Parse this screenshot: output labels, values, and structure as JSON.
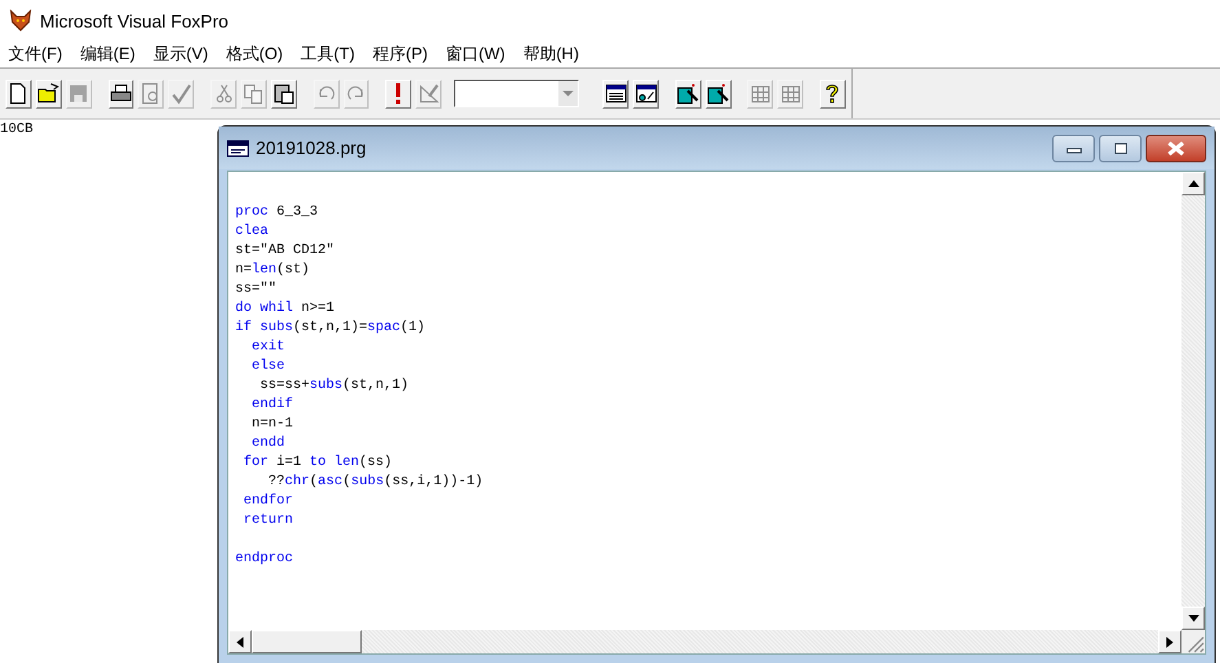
{
  "app_title": "Microsoft Visual FoxPro",
  "menu": [
    {
      "label": "文件(F)"
    },
    {
      "label": "编辑(E)"
    },
    {
      "label": "显示(V)"
    },
    {
      "label": "格式(O)"
    },
    {
      "label": "工具(T)"
    },
    {
      "label": "程序(P)"
    },
    {
      "label": "窗口(W)"
    },
    {
      "label": "帮助(H)"
    }
  ],
  "toolbar": [
    {
      "kind": "new",
      "disabled": false
    },
    {
      "kind": "open",
      "disabled": false
    },
    {
      "kind": "save",
      "disabled": true
    },
    {
      "kind": "separator"
    },
    {
      "kind": "print",
      "disabled": false
    },
    {
      "kind": "preview",
      "disabled": true
    },
    {
      "kind": "spell",
      "disabled": true
    },
    {
      "kind": "separator"
    },
    {
      "kind": "cut",
      "disabled": true
    },
    {
      "kind": "copy",
      "disabled": true
    },
    {
      "kind": "paste",
      "disabled": false
    },
    {
      "kind": "separator"
    },
    {
      "kind": "undo",
      "disabled": true
    },
    {
      "kind": "redo",
      "disabled": true
    },
    {
      "kind": "separator"
    },
    {
      "kind": "run",
      "disabled": false
    },
    {
      "kind": "modify",
      "disabled": true
    },
    {
      "kind": "combo"
    },
    {
      "kind": "separator"
    },
    {
      "kind": "form",
      "disabled": false
    },
    {
      "kind": "report",
      "disabled": false
    },
    {
      "kind": "separator"
    },
    {
      "kind": "wizard",
      "disabled": false
    },
    {
      "kind": "wizard",
      "disabled": false
    },
    {
      "kind": "separator"
    },
    {
      "kind": "grid",
      "disabled": true
    },
    {
      "kind": "grid",
      "disabled": true
    },
    {
      "kind": "separator"
    },
    {
      "kind": "help",
      "disabled": false
    }
  ],
  "desktop_text": "10CB",
  "editor": {
    "title": "20191028.prg",
    "lines": [
      {
        "tokens": [
          {
            "t": "proc",
            "kw": true
          },
          {
            "t": " 6_3_3",
            "kw": false
          }
        ]
      },
      {
        "tokens": [
          {
            "t": "clea",
            "kw": true
          }
        ]
      },
      {
        "tokens": [
          {
            "t": "st=\"AB CD12\"",
            "kw": false
          }
        ]
      },
      {
        "tokens": [
          {
            "t": "n=",
            "kw": false
          },
          {
            "t": "len",
            "kw": true
          },
          {
            "t": "(st)",
            "kw": false
          }
        ]
      },
      {
        "tokens": [
          {
            "t": "ss=\"\"",
            "kw": false
          }
        ]
      },
      {
        "tokens": [
          {
            "t": "do whil",
            "kw": true
          },
          {
            "t": " n>=1",
            "kw": false
          }
        ]
      },
      {
        "tokens": [
          {
            "t": "if subs",
            "kw": true
          },
          {
            "t": "(st,n,1)=",
            "kw": false
          },
          {
            "t": "spac",
            "kw": true
          },
          {
            "t": "(1)",
            "kw": false
          }
        ]
      },
      {
        "tokens": [
          {
            "t": "  exit",
            "kw": true
          }
        ]
      },
      {
        "tokens": [
          {
            "t": "  else",
            "kw": true
          }
        ]
      },
      {
        "tokens": [
          {
            "t": "   ss=ss+",
            "kw": false
          },
          {
            "t": "subs",
            "kw": true
          },
          {
            "t": "(st,n,1)",
            "kw": false
          }
        ]
      },
      {
        "tokens": [
          {
            "t": "  endif",
            "kw": true
          }
        ]
      },
      {
        "tokens": [
          {
            "t": "  n=n-1",
            "kw": false
          }
        ]
      },
      {
        "tokens": [
          {
            "t": "  endd",
            "kw": true
          }
        ]
      },
      {
        "tokens": [
          {
            "t": " for",
            "kw": true
          },
          {
            "t": " i=1 ",
            "kw": false
          },
          {
            "t": "to len",
            "kw": true
          },
          {
            "t": "(ss)",
            "kw": false
          }
        ]
      },
      {
        "tokens": [
          {
            "t": "    ??",
            "kw": false
          },
          {
            "t": "chr",
            "kw": true
          },
          {
            "t": "(",
            "kw": false
          },
          {
            "t": "asc",
            "kw": true
          },
          {
            "t": "(",
            "kw": false
          },
          {
            "t": "subs",
            "kw": true
          },
          {
            "t": "(ss,i,1))-1)",
            "kw": false
          }
        ]
      },
      {
        "tokens": [
          {
            "t": " endfor",
            "kw": true
          }
        ]
      },
      {
        "tokens": [
          {
            "t": " return",
            "kw": true
          }
        ]
      },
      {
        "tokens": [
          {
            "t": "endproc",
            "kw": true
          }
        ],
        "gap_before": true
      }
    ]
  }
}
